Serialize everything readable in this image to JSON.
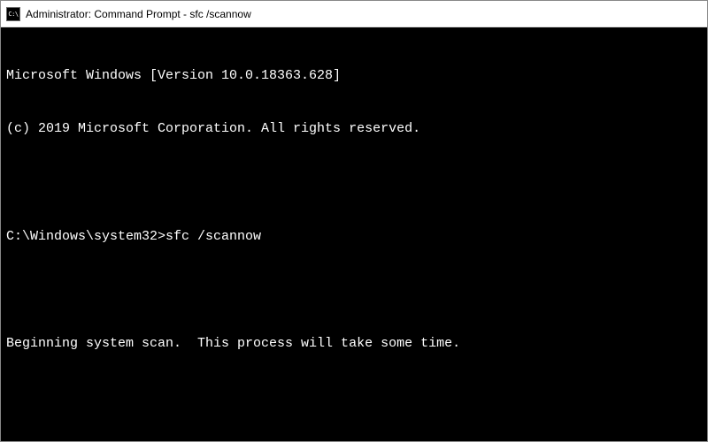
{
  "titlebar": {
    "title": "Administrator: Command Prompt - sfc  /scannow"
  },
  "terminal": {
    "lines": {
      "version": "Microsoft Windows [Version 10.0.18363.628]",
      "copyright": "(c) 2019 Microsoft Corporation. All rights reserved.",
      "prompt": "C:\\Windows\\system32>",
      "command": "sfc /scannow",
      "status": "Beginning system scan.  This process will take some time."
    }
  }
}
